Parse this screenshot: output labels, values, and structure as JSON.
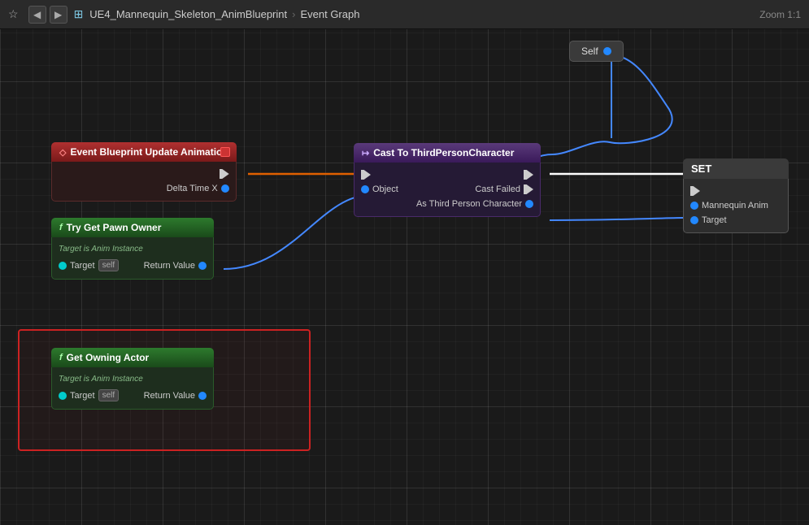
{
  "topbar": {
    "title": "UE4_Mannequin_Skeleton_AnimBlueprint",
    "graph": "Event Graph",
    "zoom": "Zoom 1:1"
  },
  "nodes": {
    "event_node": {
      "title": "Event Blueprint Update Animation",
      "icon": "◇",
      "pins_out": [
        {
          "label": "Delta Time X",
          "type": "blue"
        }
      ]
    },
    "try_get_pawn": {
      "title": "Try Get Pawn Owner",
      "subtitle": "Target is Anim Instance",
      "target_label": "Target",
      "self_label": "self",
      "return_label": "Return Value"
    },
    "get_owning_actor": {
      "title": "Get Owning Actor",
      "subtitle": "Target is Anim Instance",
      "target_label": "Target",
      "self_label": "self",
      "return_label": "Return Value"
    },
    "cast_node": {
      "title": "Cast To ThirdPersonCharacter",
      "object_label": "Object",
      "cast_failed_label": "Cast Failed",
      "as_label": "As Third Person Character"
    },
    "set_node": {
      "title": "SET",
      "mannequin_label": "Mannequin Anim",
      "target_label": "Target"
    },
    "self_node": {
      "label": "Self"
    }
  }
}
